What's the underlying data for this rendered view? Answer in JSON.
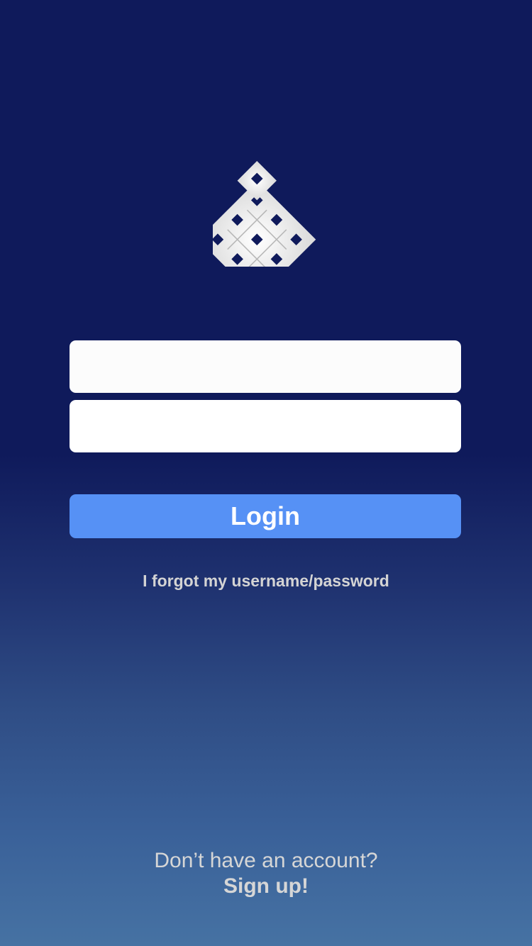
{
  "logo": {
    "icon": "endless-knot-icon"
  },
  "login_form": {
    "username": {
      "value": "",
      "placeholder": ""
    },
    "password": {
      "value": "",
      "placeholder": ""
    },
    "login_label": "Login",
    "forgot_label": "I forgot my username/password"
  },
  "signup": {
    "prompt": "Don’t have an account?",
    "link_label": "Sign up!"
  },
  "colors": {
    "background_top": "#0f1a5b",
    "background_bottom": "#4672a3",
    "button": "#5691f5",
    "field": "#ffffff",
    "link_text": "#d4d4d4"
  }
}
